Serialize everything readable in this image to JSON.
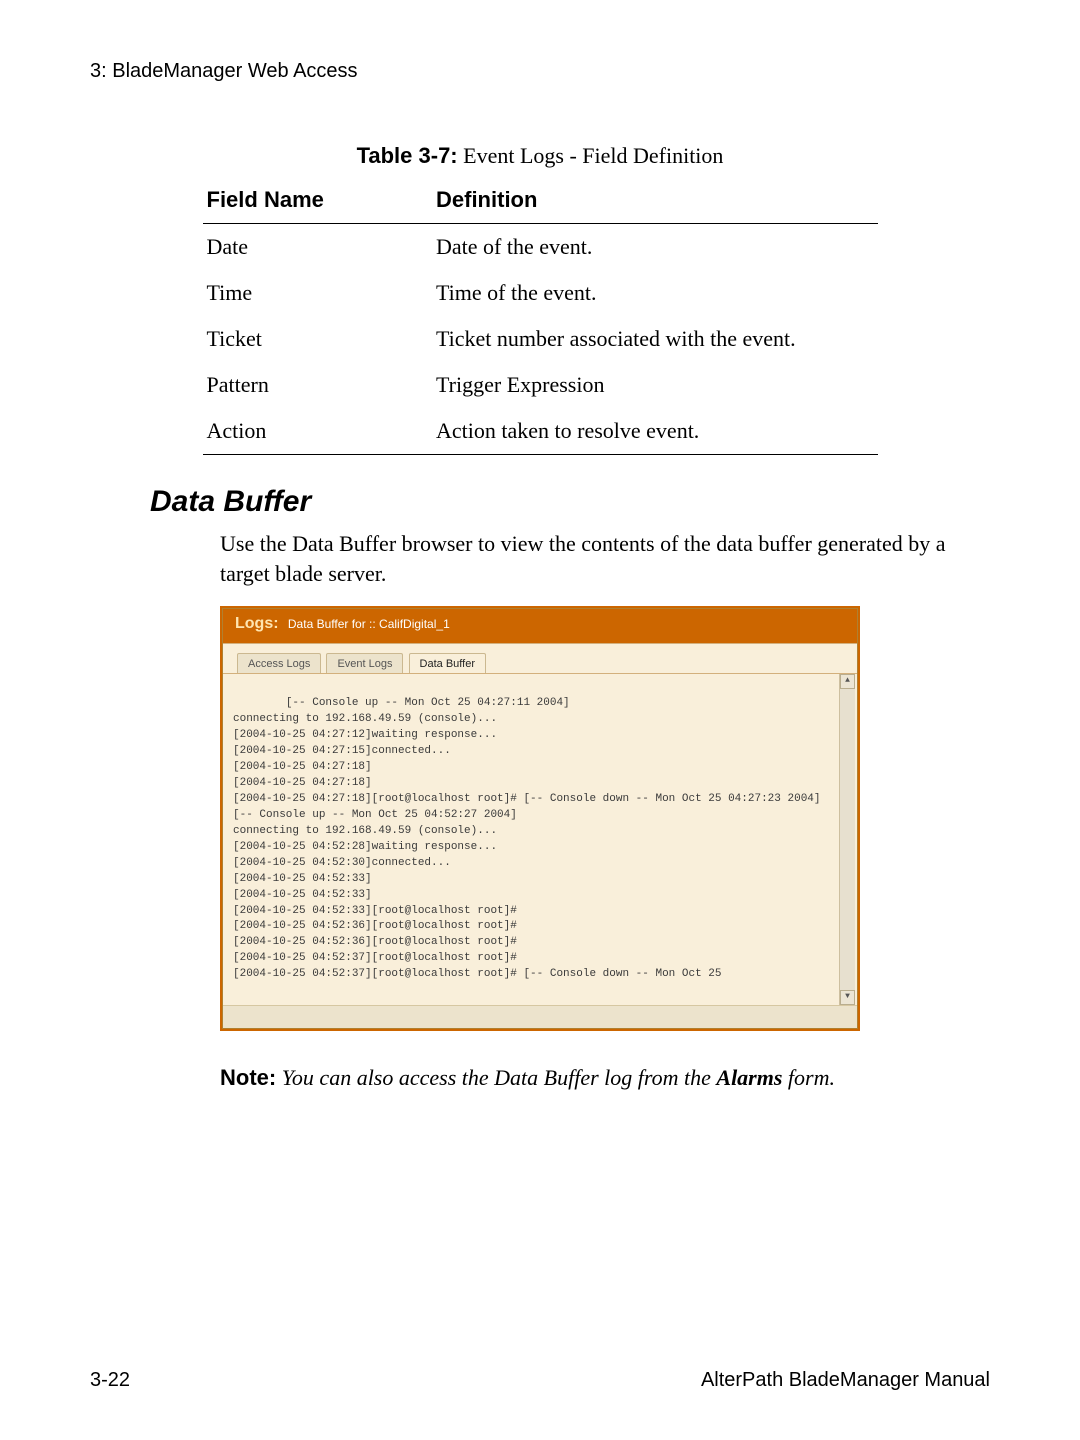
{
  "running_head": "3: BladeManager Web Access",
  "table_caption_label": "Table 3-7:",
  "table_caption_text": " Event Logs - Field Definition",
  "table_headers": {
    "field": "Field Name",
    "def": "Definition"
  },
  "table_rows": [
    {
      "field": "Date",
      "def": "Date of the event."
    },
    {
      "field": "Time",
      "def": "Time of the event."
    },
    {
      "field": "Ticket",
      "def": "Ticket number associated with the event."
    },
    {
      "field": "Pattern",
      "def": "Trigger Expression"
    },
    {
      "field": "Action",
      "def": "Action taken to resolve event."
    }
  ],
  "section_title": "Data Buffer",
  "section_para": "Use the Data Buffer browser to view the contents of the data buffer generated by a target blade server.",
  "shot": {
    "header_word": "Logs:",
    "header_text": "Data Buffer for ::  CalifDigital_1",
    "tabs": [
      "Access Logs",
      "Event Logs",
      "Data Buffer"
    ],
    "active_tab_index": 2,
    "log_lines": [
      "[-- Console up -- Mon Oct 25 04:27:11 2004]",
      "connecting to 192.168.49.59 (console)...",
      "[2004-10-25 04:27:12]waiting response...",
      "[2004-10-25 04:27:15]connected...",
      "[2004-10-25 04:27:18]",
      "[2004-10-25 04:27:18]",
      "[2004-10-25 04:27:18][root@localhost root]# [-- Console down -- Mon Oct 25 04:27:23 2004]",
      "[-- Console up -- Mon Oct 25 04:52:27 2004]",
      "connecting to 192.168.49.59 (console)...",
      "[2004-10-25 04:52:28]waiting response...",
      "[2004-10-25 04:52:30]connected...",
      "[2004-10-25 04:52:33]",
      "[2004-10-25 04:52:33]",
      "[2004-10-25 04:52:33][root@localhost root]#",
      "[2004-10-25 04:52:36][root@localhost root]#",
      "[2004-10-25 04:52:36][root@localhost root]#",
      "[2004-10-25 04:52:37][root@localhost root]#",
      "[2004-10-25 04:52:37][root@localhost root]# [-- Console down -- Mon Oct 25"
    ]
  },
  "note_label": "Note:",
  "note_text_pre": " You can also access the Data Buffer log from the ",
  "note_text_bold": "Alarms",
  "note_text_post": " form.",
  "footer_page": "3-22",
  "footer_title": "AlterPath BladeManager Manual"
}
